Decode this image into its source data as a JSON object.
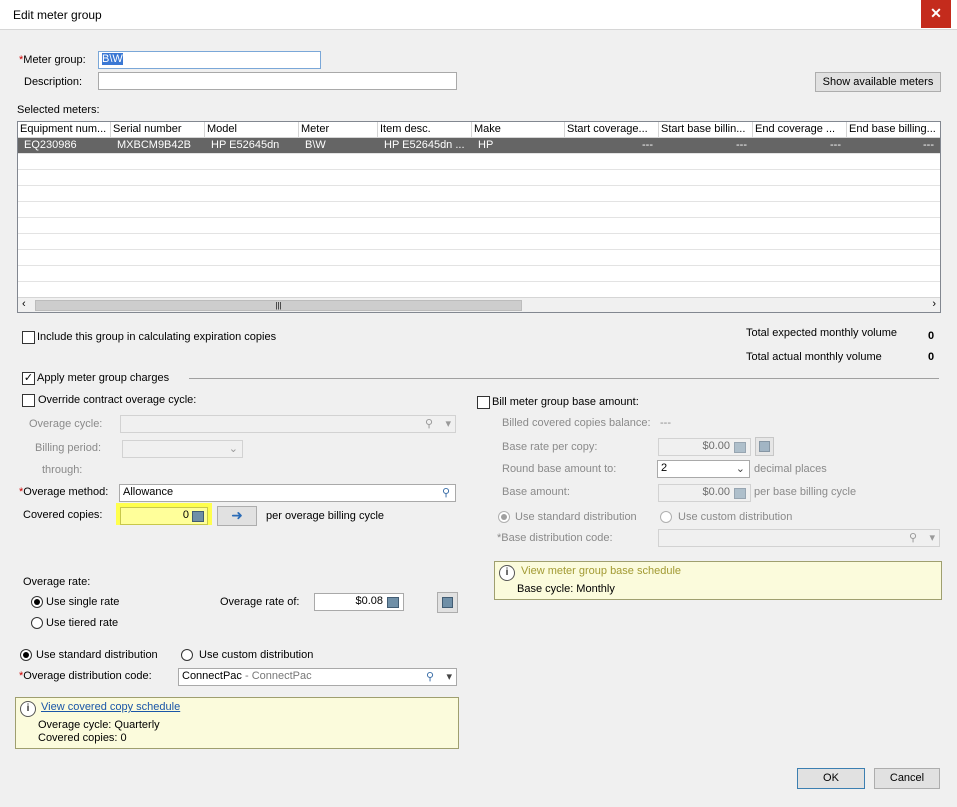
{
  "window": {
    "title": "Edit meter group",
    "close_label": "✕"
  },
  "form": {
    "meter_group_label": "Meter group:",
    "meter_group_value": "B\\W",
    "description_label": "Description:",
    "description_value": "",
    "show_meters_button": "Show available meters",
    "selected_meters_label": "Selected meters:"
  },
  "grid": {
    "columns": [
      "Equipment num...",
      "Serial number",
      "Model",
      "Meter",
      "Item desc.",
      "Make",
      "Start coverage...",
      "Start base billin...",
      "End coverage ...",
      "End base billing..."
    ],
    "rows": [
      [
        "EQ230986",
        "MXBCM9B42B",
        "HP E52645dn",
        "B\\W",
        "HP E52645dn ...",
        "HP",
        "---",
        "---",
        "---",
        "---"
      ]
    ],
    "scroll_thumb": "|||"
  },
  "expiration": {
    "include_label": "Include this group in calculating expiration copies",
    "include_checked": false,
    "total_expected_label": "Total expected monthly volume",
    "total_expected_value": "0",
    "total_actual_label": "Total actual monthly volume",
    "total_actual_value": "0"
  },
  "charges": {
    "apply_label": "Apply meter group charges",
    "apply_checked": true,
    "override_label": "Override contract overage cycle:",
    "overage_cycle_label": "Overage cycle:",
    "billing_period_label": "Billing period:",
    "through_label": "through:",
    "overage_method_label": "Overage method:",
    "overage_method_value": "Allowance",
    "covered_copies_label": "Covered copies:",
    "covered_copies_value": "0",
    "per_cycle_label": "per overage billing cycle",
    "overage_rate_label": "Overage rate:",
    "single_rate_label": "Use single rate",
    "tiered_rate_label": "Use tiered rate",
    "overage_rate_of_label": "Overage rate of:",
    "overage_rate_value": "$0.08",
    "std_dist_label": "Use standard distribution",
    "custom_dist_label": "Use custom distribution",
    "dist_code_label": "Overage distribution code:",
    "dist_code_value": "ConnectPac",
    "dist_code_desc": " - ConnectPac",
    "schedule_link": "View covered copy schedule",
    "schedule_cycle": "Overage cycle: Quarterly",
    "schedule_copies": "Covered copies: 0"
  },
  "base": {
    "bill_base_label": "Bill meter group base amount:",
    "billed_balance_label": "Billed covered copies balance:",
    "billed_balance_value": "---",
    "base_rate_label": "Base rate per copy:",
    "base_rate_value": "$0.00",
    "round_label": "Round base amount to:",
    "round_value": "2",
    "decimal_label": "decimal places",
    "base_amount_label": "Base amount:",
    "base_amount_value": "$0.00",
    "per_base_label": "per base billing cycle",
    "std_dist_label": "Use standard distribution",
    "custom_dist_label": "Use custom distribution",
    "base_dist_label": "*Base distribution code:",
    "schedule_link": "View meter group base schedule",
    "schedule_cycle": "Base cycle: Monthly"
  },
  "footer": {
    "ok": "OK",
    "cancel": "Cancel"
  },
  "colors": {
    "highlight": "#ffff4d",
    "selected_row": "#656565",
    "info_bg": "#fbfbdc"
  }
}
